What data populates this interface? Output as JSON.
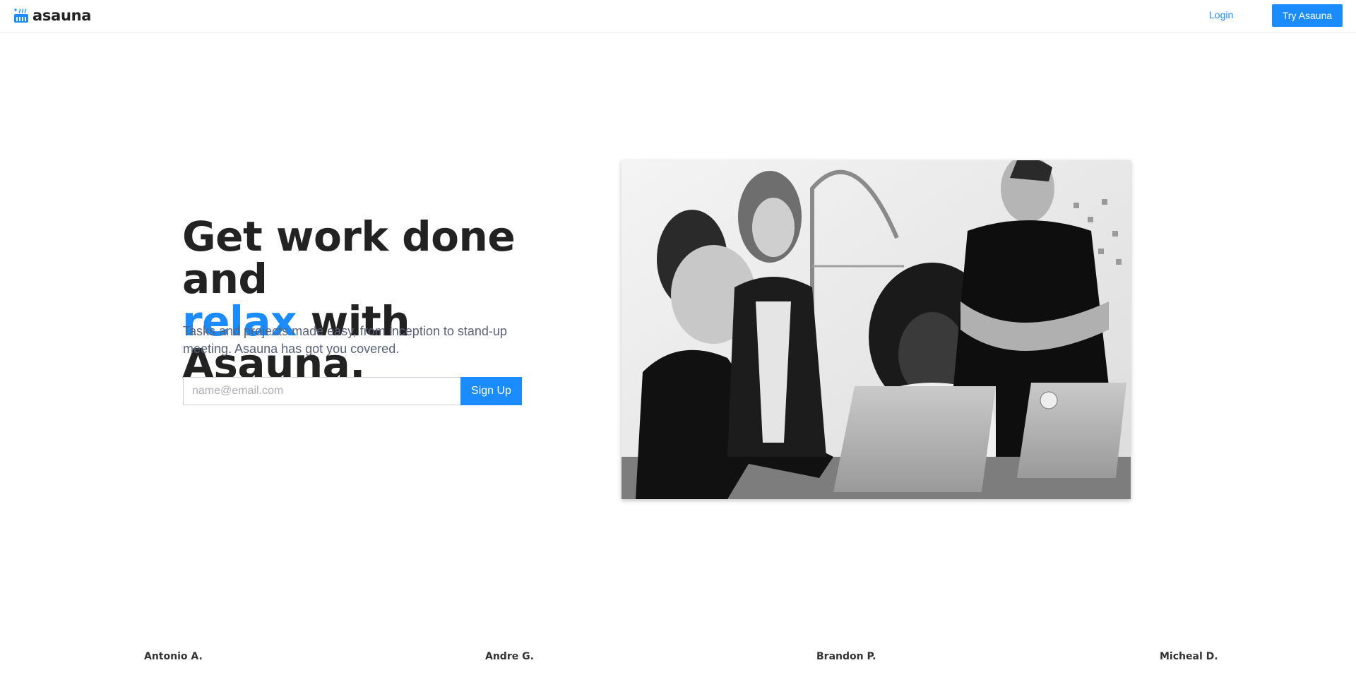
{
  "header": {
    "brand": "asauna",
    "logo_icon": "sauna-icon",
    "login_label": "Login",
    "cta_label": "Try Asauna"
  },
  "hero": {
    "title_line1": "Get work done and",
    "title_accent": "relax",
    "title_rest": " with Asauna.",
    "subtitle": "Tasks and projects made easy, from inception to stand-up meeting. Asauna has got you covered.",
    "email_placeholder": "name@email.com",
    "email_value": "",
    "signup_label": "Sign Up"
  },
  "testimonials": {
    "names": [
      "Antonio A.",
      "Andre G.",
      "Brandon P.",
      "Micheal D."
    ]
  },
  "colors": {
    "accent": "#1a8cff",
    "text": "#222222",
    "muted": "#5a6278",
    "border": "#ced4da"
  }
}
